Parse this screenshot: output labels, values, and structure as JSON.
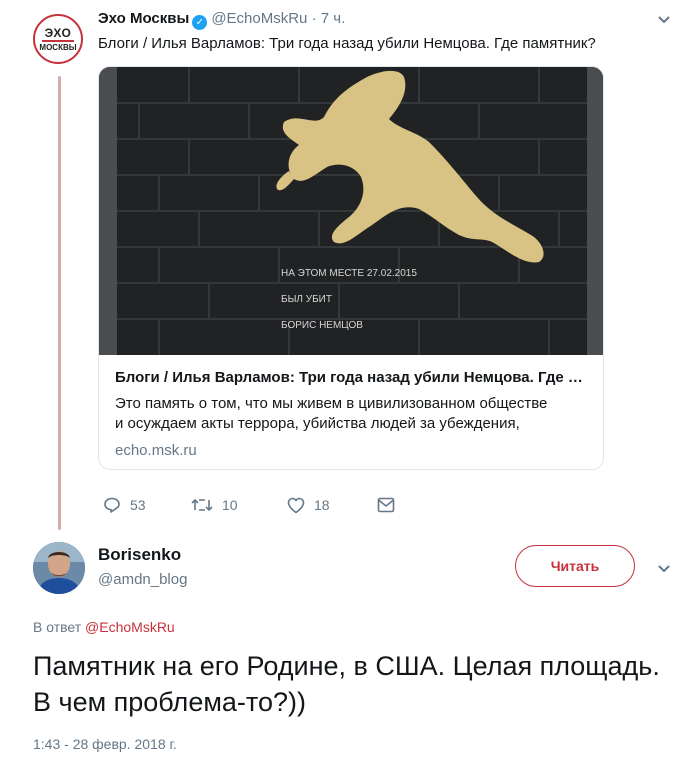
{
  "tweet": {
    "avatar_line1": "ЭХО",
    "avatar_line2": "МОСКВЫ",
    "author_name": "Эхо Москвы",
    "handle": "@EchoMskRu",
    "separator": "·",
    "time": "7 ч.",
    "text": "Блоги / Илья Варламов: Три года назад убили Немцова. Где памятник?",
    "card": {
      "image_caption": [
        "НА ЭТОМ МЕСТЕ 27.02.2015",
        "БЫЛ УБИТ",
        "БОРИС НЕМЦОВ"
      ],
      "title": "Блоги / Илья Варламов: Три года назад убили Немцова. Где памя...",
      "description_line1": "Это память о том, что мы живем в цивилизованном обществе",
      "description_line2": "и осуждаем акты террора, убийства людей за убеждения,",
      "url": "echo.msk.ru"
    },
    "actions": {
      "replies": "53",
      "retweets": "10",
      "likes": "18"
    }
  },
  "reply": {
    "author_name": "Borisenko",
    "handle": "@amdn_blog",
    "follow_label": "Читать",
    "reply_to_prefix": "В ответ",
    "reply_to_mention": "@EchoMskRu",
    "text": "Памятник на его Родине, в США. Целая площадь. В чем проблема-то?))",
    "timestamp": "1:43 - 28 февр. 2018 г."
  },
  "colors": {
    "accent": "#c6323c",
    "verified": "#1da1f2",
    "muted": "#657786",
    "thread_line": "#d8aab0"
  },
  "icons": [
    "verified-icon",
    "chevron-down-icon",
    "reply-icon",
    "retweet-icon",
    "like-icon",
    "message-icon"
  ]
}
